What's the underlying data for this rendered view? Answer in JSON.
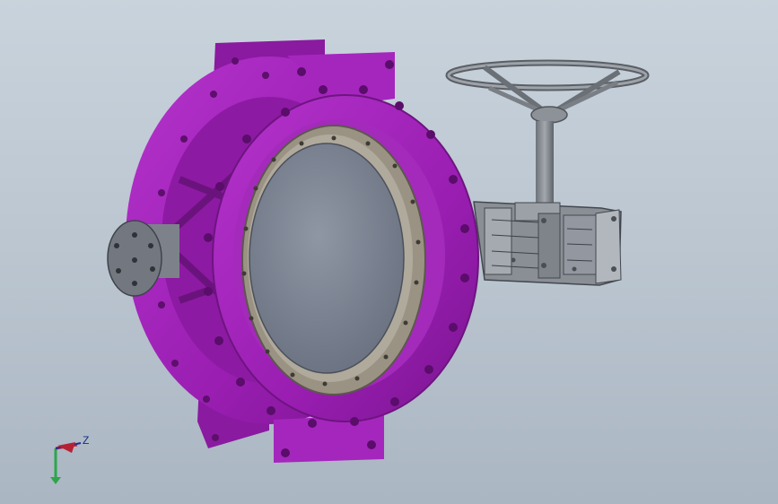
{
  "viewport": {
    "model": "butterfly-valve-with-gearbox-handwheel",
    "colors": {
      "background_top": "#c9d3dc",
      "background_bottom": "#aab6c2",
      "body": "#9b1fb3",
      "body_shadow": "#6e1480",
      "body_highlight": "#c23fd8",
      "seat_ring": "#9a9384",
      "disc": "#7e8594",
      "steel": "#8a8f96",
      "steel_dark": "#4c5057"
    }
  },
  "triad": {
    "z_label": "Z",
    "icons": [
      "x-axis-icon",
      "y-axis-icon",
      "z-axis-icon"
    ]
  }
}
